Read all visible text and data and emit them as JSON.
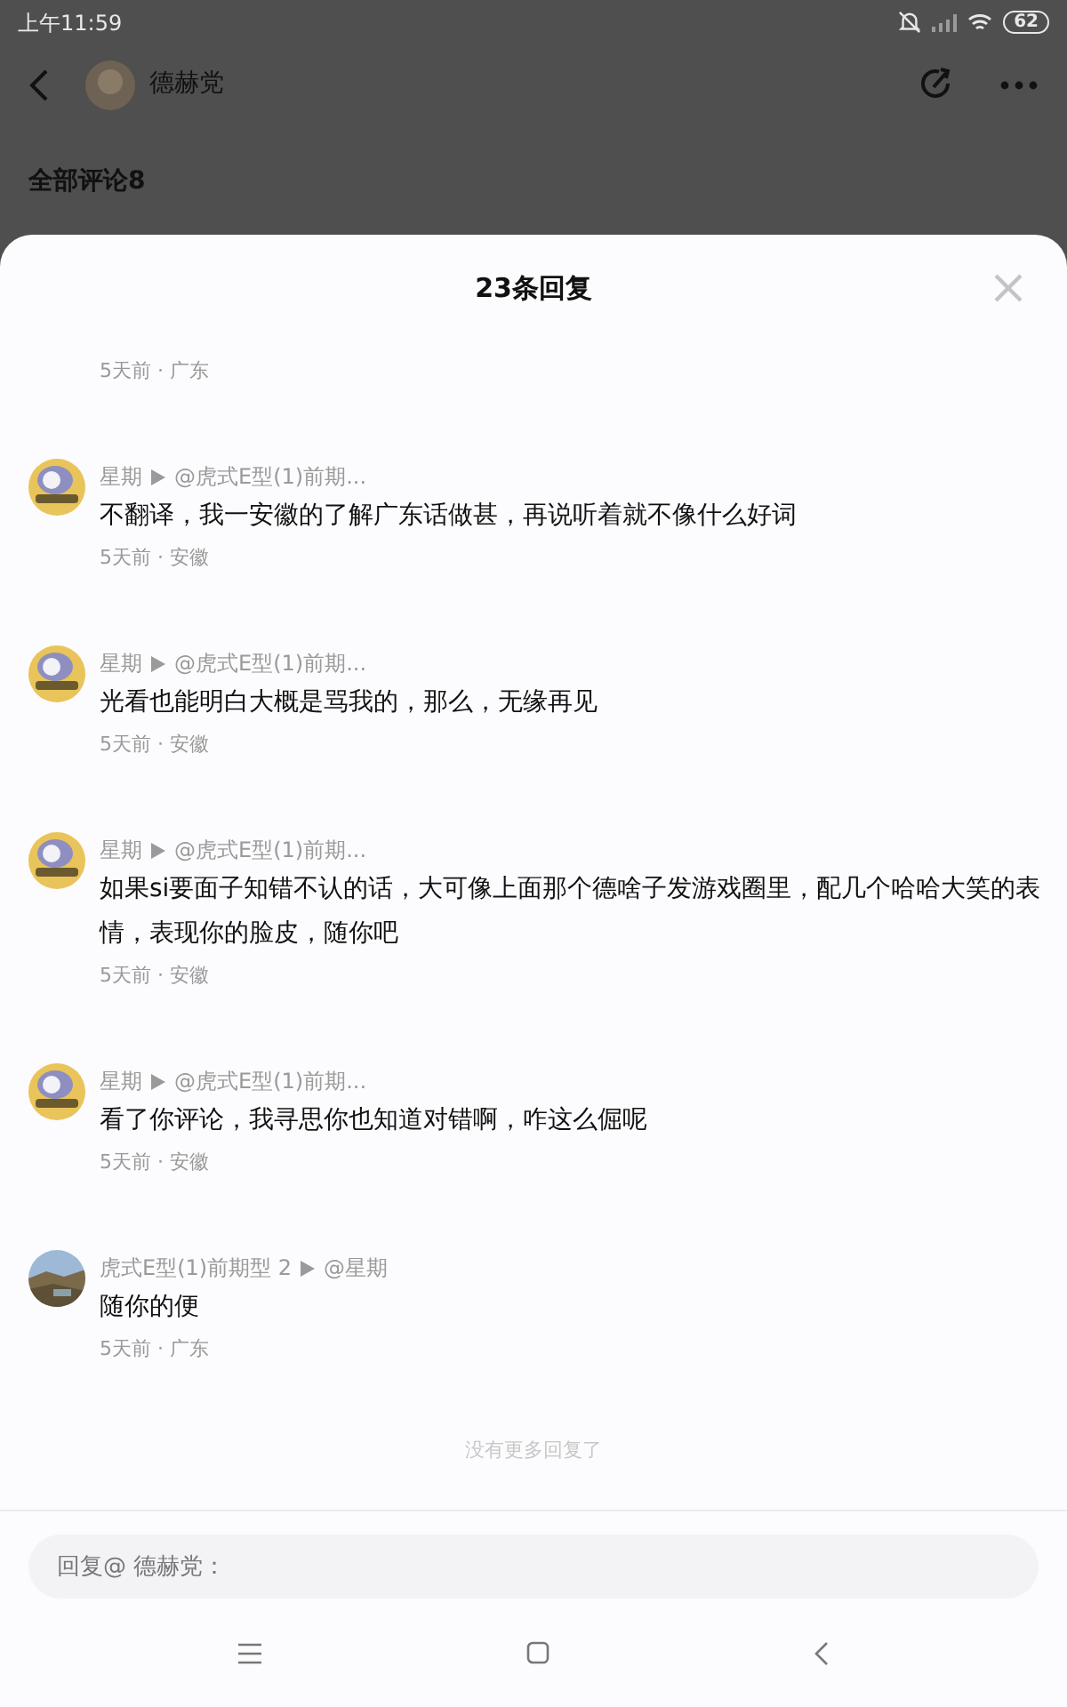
{
  "status_bar": {
    "time": "上午11:59",
    "battery": "62"
  },
  "header": {
    "username": "德赫党"
  },
  "comments_heading": "全部评论8",
  "sheet": {
    "title": "23条回复",
    "partial_meta": "5天前 · 广东",
    "replies": [
      {
        "author": "星期",
        "target": "@虎式E型(1)前期...",
        "text": "不翻译，我一安徽的了解广东话做甚，再说听着就不像什么好词",
        "meta": "5天前 · 安徽",
        "kind": "cartoon"
      },
      {
        "author": "星期",
        "target": "@虎式E型(1)前期...",
        "text": "光看也能明白大概是骂我的，那么，无缘再见",
        "meta": "5天前 · 安徽",
        "kind": "cartoon"
      },
      {
        "author": "星期",
        "target": "@虎式E型(1)前期...",
        "text": "如果si要面子知错不认的话，大可像上面那个德啥子发游戏圈里，配几个哈哈大笑的表情，表现你的脸皮，随你吧",
        "meta": "5天前 · 安徽",
        "kind": "cartoon"
      },
      {
        "author": "星期",
        "target": "@虎式E型(1)前期...",
        "text": "看了你评论，我寻思你也知道对错啊，咋这么倔呢",
        "meta": "5天前 · 安徽",
        "kind": "cartoon"
      },
      {
        "author": "虎式E型(1)前期型 2",
        "target": "@星期",
        "text": "随你的便",
        "meta": "5天前 · 广东",
        "kind": "picture"
      }
    ],
    "end_text": "没有更多回复了",
    "reply_field": {
      "placeholder": "回复@ 德赫党："
    }
  }
}
